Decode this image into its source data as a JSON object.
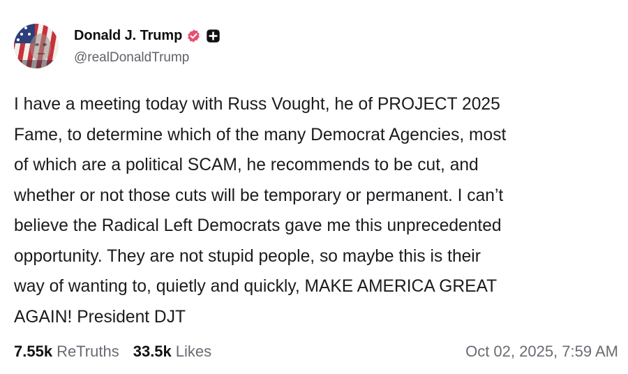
{
  "author": {
    "display_name": "Donald J. Trump",
    "handle": "@realDonaldTrump",
    "avatar_icon": "flag-portrait-avatar",
    "verified_color": "#e8506f"
  },
  "post": {
    "text": "I have a meeting today with Russ Vought, he of PROJECT 2025\nFame,  to determine which of the many Democrat Agencies, most\nof which are a political SCAM, he recommends to be cut, and\nwhether or not those cuts will be temporary or permanent. I can’t\nbelieve the Radical Left Democrats gave me this unprecedented\nopportunity. They are not stupid people, so maybe this is their\nway of wanting to, quietly and quickly, MAKE AMERICA GREAT\nAGAIN! President DJT"
  },
  "stats": {
    "retruths_count": "7.55k",
    "retruths_label": "ReTruths",
    "likes_count": "33.5k",
    "likes_label": "Likes",
    "timestamp": "Oct 02, 2025, 7:59 AM"
  }
}
